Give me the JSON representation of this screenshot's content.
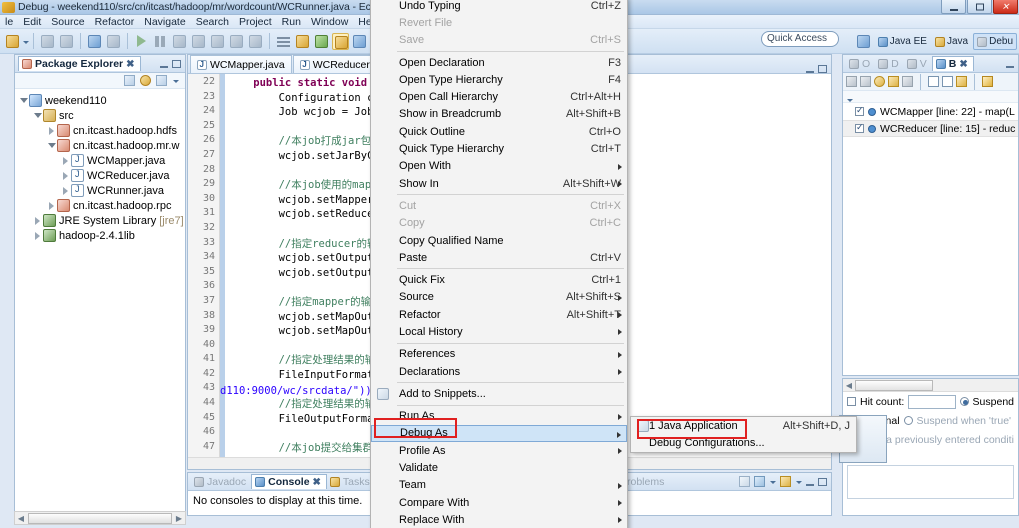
{
  "window": {
    "title": "Debug - weekend110/src/cn/itcast/hadoop/mr/wordcount/WCRunner.java - Eclip",
    "minimize_label": "–",
    "maximize_label": "",
    "close_label": "✕"
  },
  "menubar": {
    "items": [
      "le",
      "Edit",
      "Source",
      "Refactor",
      "Navigate",
      "Search",
      "Project",
      "Run",
      "Window",
      "Help"
    ]
  },
  "toolbar": {
    "quick_access_placeholder": "Quick Access",
    "perspectives": [
      {
        "label": "Java EE",
        "selected": false
      },
      {
        "label": "Java",
        "selected": false
      },
      {
        "label": "Debu",
        "selected": true
      }
    ]
  },
  "package_explorer": {
    "title": "Package Explorer",
    "close_label": "✖",
    "tree": [
      {
        "label": "weekend110",
        "icon": "project-icon",
        "indent": 0,
        "twist": "open"
      },
      {
        "label": "src",
        "icon": "source-folder-icon",
        "indent": 1,
        "twist": "open"
      },
      {
        "label": "cn.itcast.hadoop.hdfs",
        "icon": "package-icon",
        "indent": 2,
        "twist": "closed"
      },
      {
        "label": "cn.itcast.hadoop.mr.w",
        "icon": "package-icon",
        "indent": 2,
        "twist": "open"
      },
      {
        "label": "WCMapper.java",
        "icon": "java-file-icon",
        "indent": 3,
        "twist": "closed"
      },
      {
        "label": "WCReducer.java",
        "icon": "java-file-icon",
        "indent": 3,
        "twist": "closed"
      },
      {
        "label": "WCRunner.java",
        "icon": "java-file-icon",
        "indent": 3,
        "twist": "closed"
      },
      {
        "label": "cn.itcast.hadoop.rpc",
        "icon": "package-icon",
        "indent": 2,
        "twist": "closed"
      },
      {
        "label": "JRE System Library",
        "suffix": "[jre7]",
        "icon": "library-icon",
        "indent": 1,
        "twist": "closed"
      },
      {
        "label": "hadoop-2.4.1lib",
        "icon": "library-icon",
        "indent": 1,
        "twist": "closed"
      }
    ]
  },
  "editor": {
    "tabs": [
      {
        "label": "WCMapper.java",
        "selected": false
      },
      {
        "label": "WCReducer.java",
        "selected": false
      }
    ],
    "first_line": 22,
    "lines": [
      {
        "n": 22,
        "text": "    public static void m",
        "kind": "code"
      },
      {
        "n": 23,
        "text": "        Configuration co",
        "kind": "code"
      },
      {
        "n": 24,
        "text": "        Job wcjob = Job.g",
        "kind": "code"
      },
      {
        "n": 25,
        "text": "",
        "kind": "code"
      },
      {
        "n": 26,
        "text": "        //本job打成jar包的",
        "kind": "comment"
      },
      {
        "n": 27,
        "text": "        wcjob.setJarByCla",
        "kind": "code"
      },
      {
        "n": 28,
        "text": "",
        "kind": "code"
      },
      {
        "n": 29,
        "text": "        //本job使用的mapp",
        "kind": "comment"
      },
      {
        "n": 30,
        "text": "        wcjob.setMapperCl",
        "kind": "code"
      },
      {
        "n": 31,
        "text": "        wcjob.setReducerC",
        "kind": "code"
      },
      {
        "n": 32,
        "text": "",
        "kind": "code"
      },
      {
        "n": 33,
        "text": "        //指定reducer的输",
        "kind": "comment"
      },
      {
        "n": 34,
        "text": "        wcjob.setOutputKe",
        "kind": "code"
      },
      {
        "n": 35,
        "text": "        wcjob.setOutputVa",
        "kind": "code"
      },
      {
        "n": 36,
        "text": "",
        "kind": "code"
      },
      {
        "n": 37,
        "text": "        //指定mapper的输出",
        "kind": "comment"
      },
      {
        "n": 38,
        "text": "        wcjob.setMapOutpu",
        "kind": "code"
      },
      {
        "n": 39,
        "text": "        wcjob.setMapOutpu",
        "kind": "code"
      },
      {
        "n": 40,
        "text": "",
        "kind": "code"
      },
      {
        "n": 41,
        "text": "        //指定处理结果的输",
        "kind": "comment"
      },
      {
        "n": 42,
        "text": "        FileInputFormat.s",
        "kind": "code"
      },
      {
        "n": 43,
        "text": "",
        "kind": "code"
      },
      {
        "n": 44,
        "text": "        //指定处理结果的输",
        "kind": "comment"
      },
      {
        "n": 45,
        "text": "        FileOutputFormat",
        "kind": "code"
      },
      {
        "n": 46,
        "text": "",
        "kind": "code"
      },
      {
        "n": 47,
        "text": "        //本job提交给集群",
        "kind": "comment"
      }
    ],
    "right_fragment_line": "d110:9000/wc/srcdata/\"));"
  },
  "context_menu": {
    "items": [
      {
        "label": "Undo Typing",
        "accel": "Ctrl+Z",
        "disabled": false
      },
      {
        "label": "Revert File",
        "accel": "",
        "disabled": true
      },
      {
        "label": "Save",
        "accel": "Ctrl+S",
        "disabled": true
      },
      {
        "sep": true
      },
      {
        "label": "Open Declaration",
        "accel": "F3"
      },
      {
        "label": "Open Type Hierarchy",
        "accel": "F4"
      },
      {
        "label": "Open Call Hierarchy",
        "accel": "Ctrl+Alt+H"
      },
      {
        "label": "Show in Breadcrumb",
        "accel": "Alt+Shift+B"
      },
      {
        "label": "Quick Outline",
        "accel": "Ctrl+O"
      },
      {
        "label": "Quick Type Hierarchy",
        "accel": "Ctrl+T"
      },
      {
        "label": "Open With",
        "accel": "",
        "submenu": true
      },
      {
        "label": "Show In",
        "accel": "Alt+Shift+W",
        "submenu": true
      },
      {
        "sep": true
      },
      {
        "label": "Cut",
        "accel": "Ctrl+X",
        "disabled": true
      },
      {
        "label": "Copy",
        "accel": "Ctrl+C",
        "disabled": true
      },
      {
        "label": "Copy Qualified Name",
        "accel": ""
      },
      {
        "label": "Paste",
        "accel": "Ctrl+V"
      },
      {
        "sep": true
      },
      {
        "label": "Quick Fix",
        "accel": "Ctrl+1"
      },
      {
        "label": "Source",
        "accel": "Alt+Shift+S",
        "submenu": true
      },
      {
        "label": "Refactor",
        "accel": "Alt+Shift+T",
        "submenu": true
      },
      {
        "label": "Local History",
        "accel": "",
        "submenu": true
      },
      {
        "sep": true
      },
      {
        "label": "References",
        "accel": "",
        "submenu": true
      },
      {
        "label": "Declarations",
        "accel": "",
        "submenu": true
      },
      {
        "sep": true
      },
      {
        "label": "Add to Snippets...",
        "accel": "",
        "icon": "snippet-icon"
      },
      {
        "sep": true
      },
      {
        "label": "Run As",
        "accel": "",
        "submenu": true
      },
      {
        "label": "Debug As",
        "accel": "",
        "submenu": true,
        "selected": true
      },
      {
        "label": "Profile As",
        "accel": "",
        "submenu": true
      },
      {
        "label": "Validate",
        "accel": ""
      },
      {
        "label": "Team",
        "accel": "",
        "submenu": true
      },
      {
        "label": "Compare With",
        "accel": "",
        "submenu": true
      },
      {
        "label": "Replace With",
        "accel": "",
        "submenu": true
      }
    ]
  },
  "debug_submenu": {
    "items": [
      {
        "label": "1 Java Application",
        "accel": "Alt+Shift+D, J",
        "highlighted": true,
        "icon": "java-app-icon"
      },
      {
        "label": "Debug Configurations...",
        "accel": ""
      }
    ]
  },
  "console_view": {
    "tabs": [
      {
        "label": "Javadoc",
        "selected": false,
        "dim": true
      },
      {
        "label": "Console",
        "selected": true,
        "dim": false
      },
      {
        "label": "Tasks",
        "selected": false,
        "dim": true
      }
    ],
    "close_label": "✖",
    "message": "No consoles to display at this time."
  },
  "problems_view": {
    "title": "Problems"
  },
  "breakpoints_view": {
    "tabs": [
      {
        "label": "O",
        "name": "outline",
        "selected": false
      },
      {
        "label": "D",
        "name": "debug",
        "selected": false
      },
      {
        "label": "V",
        "name": "variables",
        "selected": false
      },
      {
        "label": "B",
        "name": "breakpoints",
        "selected": true
      }
    ],
    "close_label": "✖",
    "items": [
      {
        "label": "WCMapper [line: 22] - map(L",
        "checked": true,
        "selected": false
      },
      {
        "label": "WCReducer [line: 15] - reduc",
        "checked": true,
        "selected": true
      }
    ]
  },
  "breakpoint_properties": {
    "hit_count_label": "Hit count:",
    "hit_count_value": "",
    "suspend_label": "Suspend",
    "conditional_label": "Conditional",
    "suspend_when_true_label": "Suspend when 'true'",
    "condition_placeholder": "Choose a previously entered conditi"
  },
  "colors": {
    "accent": "#cfe4f7",
    "highlight_red": "#e02020",
    "keyword": "#7f0055",
    "comment": "#3f7f5f",
    "string": "#2a00ff"
  }
}
